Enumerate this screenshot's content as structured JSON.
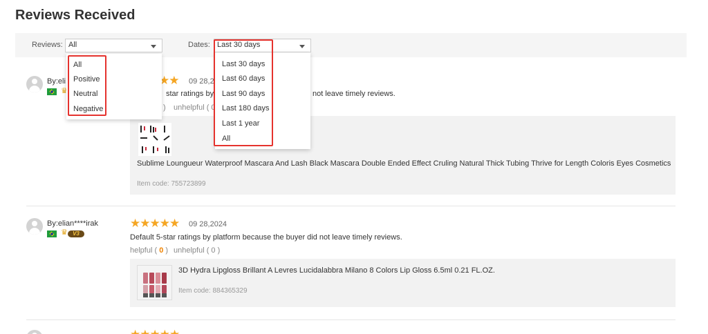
{
  "page": {
    "title": "Reviews Received"
  },
  "filters": {
    "reviews_label": "Reviews:",
    "reviews_value": "All",
    "reviews_options": [
      "All",
      "Positive",
      "Neutral",
      "Negative"
    ],
    "dates_label": "Dates:",
    "dates_value": "Last 30 days",
    "dates_options": [
      "Last 30 days",
      "Last 60 days",
      "Last 90 days",
      "Last 180 days",
      "Last 1 year",
      "All"
    ]
  },
  "reviews": [
    {
      "by": "By:eli",
      "date": "09 28,2",
      "rating": 5,
      "text_part1": "star ratings by p",
      "text_part2": "not leave timely reviews.",
      "helpful_tail": ")",
      "unhelpful": "unhelpful ( 0",
      "product_title": "Sublime Loungueur Waterproof Mascara And Lash Black Mascara Double Ended Effect Cruling Natural Thick Tubing Thrive for Length Coloris Eyes Cosmetics",
      "item_code": "Item code: 755723899"
    },
    {
      "by": "By:elian****irak",
      "date": "09 28,2024",
      "rating": 5,
      "vip": "V3",
      "text": "Default 5-star ratings by platform because the buyer did not leave timely reviews.",
      "helpful_label": "helpful (",
      "helpful_count": "0",
      "helpful_close": ")",
      "unhelpful": "unhelpful ( 0 )",
      "product_title": "3D Hydra Lipgloss Brillant A Levres Lucidalabbra Milano 8 Colors Lip Gloss 6.5ml 0.21 FL.OZ.",
      "item_code": "Item code: 884365329"
    }
  ],
  "colors": {
    "accent": "#f08300",
    "star": "#f5a623",
    "highlight": "#e5322d"
  }
}
